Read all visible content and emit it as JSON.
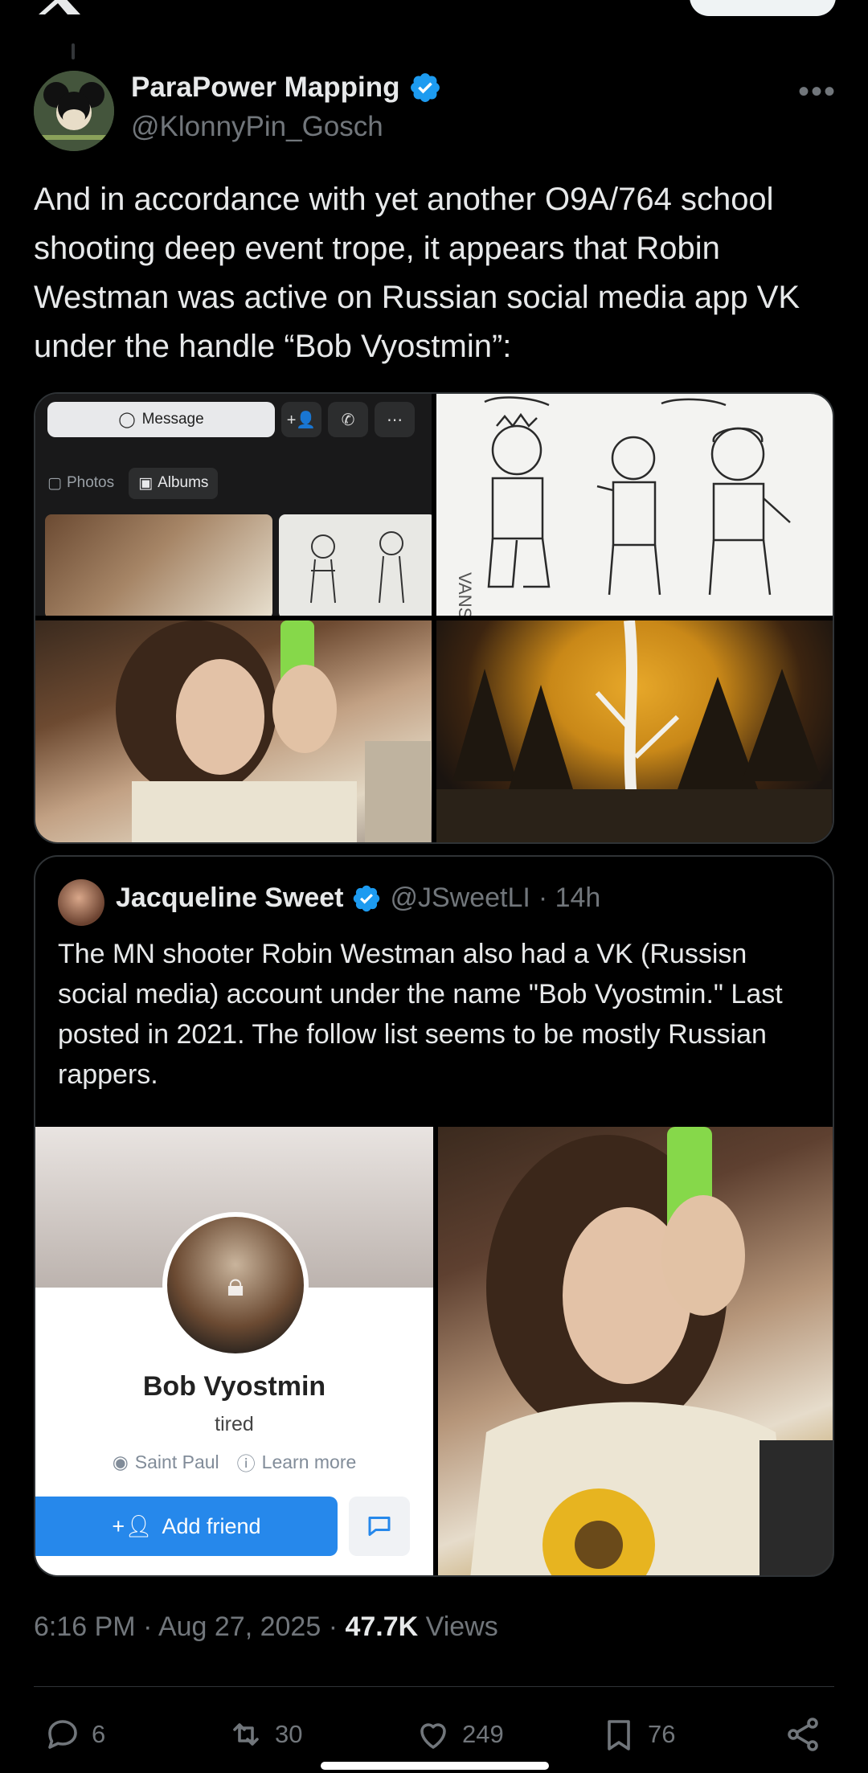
{
  "colors": {
    "accent": "#1d9bf0",
    "muted": "#71767b",
    "vk_blue": "#2688eb"
  },
  "tweet": {
    "author_name": "ParaPower Mapping",
    "author_handle": "@KlonnyPin_Gosch",
    "text": "And in accordance with yet another O9A/764 school shooting deep event trope, it appears that Robin Westman was active on Russian social media app VK under the handle “Bob Vyostmin”:",
    "media": {
      "vk_message_label": "Message",
      "vk_photos_tab": "Photos",
      "vk_albums_tab": "Albums",
      "sketch_label": "VANS"
    }
  },
  "quote": {
    "author_name": "Jacqueline Sweet",
    "author_handle": "@JSweetLI",
    "time": "· 14h",
    "text": "The MN shooter Robin Westman also had a VK (Russisn social media) account under the name \"Bob Vyostmin.\" Last posted in 2021.  The follow list seems to be mostly Russian rappers.",
    "vk_profile": {
      "name": "Bob Vyostmin",
      "status": "tired",
      "location": "Saint Paul",
      "learn_more": "Learn more",
      "add_friend": "Add friend"
    }
  },
  "footer": {
    "time": "6:16 PM · Aug 27, 2025 · ",
    "views_count": "47.7K",
    "views_label": " Views",
    "replies": "6",
    "reposts": "30",
    "likes": "249",
    "bookmarks": "76"
  }
}
